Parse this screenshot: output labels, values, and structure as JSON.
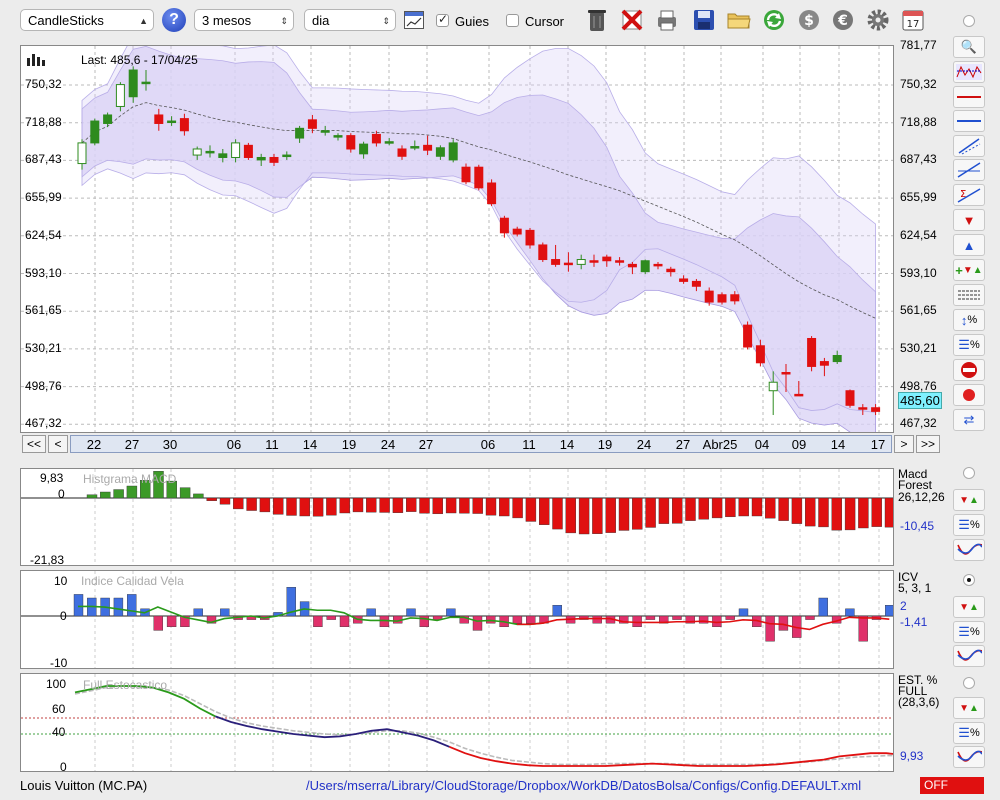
{
  "toolbar": {
    "chart_type": "CandleSticks",
    "period": "3 mesos",
    "interval": "dia",
    "guides_label": "Guies",
    "guides_checked": true,
    "cursor_label": "Cursor",
    "cursor_checked": false,
    "calendar_day": "17"
  },
  "main_chart": {
    "last_label": "Last: 485,6 - 17/04/25",
    "current_price": "485,60",
    "price_ticks": [
      "750,32",
      "718,88",
      "687,43",
      "655,99",
      "624,54",
      "593,10",
      "561,65",
      "530,21",
      "498,76",
      "467,32"
    ],
    "top_partial_tick": "781,77",
    "nav_prev_fast": "<<",
    "nav_prev": "<",
    "nav_next": ">",
    "nav_next_fast": ">>",
    "date_ticks": [
      "22",
      "27",
      "30",
      "06",
      "11",
      "14",
      "19",
      "24",
      "27",
      "06",
      "11",
      "14",
      "19",
      "24",
      "27",
      "Abr25",
      "04",
      "09",
      "14",
      "17"
    ]
  },
  "macd_pane": {
    "title": "Histgrama MACD",
    "name": "Macd",
    "name2": "Forest",
    "params": "26,12,26",
    "value": "-10,45",
    "scale_top": "9,83",
    "scale_zero": "0",
    "scale_bottom": "-21,83"
  },
  "icv_pane": {
    "title": "Indice Calidad Vela",
    "name": "ICV",
    "params": "5, 3, 1",
    "value1": "2",
    "value2": "-1,41",
    "scale_top": "10",
    "scale_zero": "0",
    "scale_bottom": "-10"
  },
  "stoch_pane": {
    "title": "Full Estocastico",
    "name": "EST. %",
    "name2": "FULL",
    "params": "(28,3,6)",
    "value": "9,93",
    "scale_100": "100",
    "scale_60": "60",
    "scale_40": "40",
    "scale_0": "0"
  },
  "status": {
    "symbol": "Louis Vuitton (MC.PA)",
    "path": "/Users/mserra/Library/CloudStorage/Dropbox/WorkDB/DatosBolsa/Configs/Config.DEFAULT.xml",
    "state": "OFF"
  },
  "colors": {
    "up": "#2e8b1e",
    "down": "#e01010",
    "band": "#d9d2f5",
    "macd_pos": "#3c9a28",
    "icv_pos": "#3f6fe0",
    "icv_neg": "#e0306a",
    "signal_green": "#2a9a1a",
    "signal_red": "#e01010",
    "stoch_navy": "#2a1f7a"
  },
  "chart_data": {
    "type": "candlestick",
    "y_range": [
      467.32,
      781.77
    ],
    "candles": [
      {
        "o": 685,
        "c": 702,
        "h": 705,
        "l": 680
      },
      {
        "o": 702,
        "c": 720,
        "h": 722,
        "l": 700
      },
      {
        "o": 718,
        "c": 725,
        "h": 727,
        "l": 715
      },
      {
        "o": 732,
        "c": 750,
        "h": 752,
        "l": 728
      },
      {
        "o": 740,
        "c": 762,
        "h": 765,
        "l": 735
      },
      {
        "o": 752,
        "c": 752,
        "h": 762,
        "l": 745
      },
      {
        "o": 725,
        "c": 718,
        "h": 730,
        "l": 712
      },
      {
        "o": 720,
        "c": 720,
        "h": 724,
        "l": 716
      },
      {
        "o": 722,
        "c": 712,
        "h": 726,
        "l": 708
      },
      {
        "o": 692,
        "c": 697,
        "h": 699,
        "l": 688
      },
      {
        "o": 695,
        "c": 695,
        "h": 700,
        "l": 690
      },
      {
        "o": 690,
        "c": 693,
        "h": 697,
        "l": 686
      },
      {
        "o": 690,
        "c": 702,
        "h": 705,
        "l": 686
      },
      {
        "o": 700,
        "c": 690,
        "h": 702,
        "l": 688
      },
      {
        "o": 688,
        "c": 690,
        "h": 693,
        "l": 683
      },
      {
        "o": 690,
        "c": 686,
        "h": 693,
        "l": 683
      },
      {
        "o": 692,
        "c": 692,
        "h": 695,
        "l": 688
      },
      {
        "o": 706,
        "c": 714,
        "h": 716,
        "l": 702
      },
      {
        "o": 721,
        "c": 714,
        "h": 725,
        "l": 710
      },
      {
        "o": 712,
        "c": 712,
        "h": 716,
        "l": 708
      },
      {
        "o": 708,
        "c": 708,
        "h": 710,
        "l": 704
      },
      {
        "o": 708,
        "c": 697,
        "h": 710,
        "l": 694
      },
      {
        "o": 693,
        "c": 701,
        "h": 703,
        "l": 689
      },
      {
        "o": 709,
        "c": 702,
        "h": 712,
        "l": 699
      },
      {
        "o": 703,
        "c": 703,
        "h": 706,
        "l": 700
      },
      {
        "o": 697,
        "c": 691,
        "h": 700,
        "l": 688
      },
      {
        "o": 699,
        "c": 699,
        "h": 704,
        "l": 696
      },
      {
        "o": 700,
        "c": 696,
        "h": 708,
        "l": 692
      },
      {
        "o": 691,
        "c": 698,
        "h": 700,
        "l": 688
      },
      {
        "o": 688,
        "c": 702,
        "h": 705,
        "l": 686
      },
      {
        "o": 682,
        "c": 670,
        "h": 685,
        "l": 668
      },
      {
        "o": 682,
        "c": 665,
        "h": 684,
        "l": 663
      },
      {
        "o": 669,
        "c": 652,
        "h": 672,
        "l": 650
      },
      {
        "o": 640,
        "c": 628,
        "h": 642,
        "l": 624
      },
      {
        "o": 631,
        "c": 627,
        "h": 633,
        "l": 625
      },
      {
        "o": 630,
        "c": 618,
        "h": 632,
        "l": 615
      },
      {
        "o": 618,
        "c": 606,
        "h": 620,
        "l": 604
      },
      {
        "o": 606,
        "c": 602,
        "h": 618,
        "l": 600
      },
      {
        "o": 603,
        "c": 603,
        "h": 612,
        "l": 596
      },
      {
        "o": 602,
        "c": 606,
        "h": 610,
        "l": 598
      },
      {
        "o": 605,
        "c": 605,
        "h": 610,
        "l": 600
      },
      {
        "o": 608,
        "c": 605,
        "h": 610,
        "l": 600
      },
      {
        "o": 605,
        "c": 605,
        "h": 608,
        "l": 601
      },
      {
        "o": 602,
        "c": 600,
        "h": 604,
        "l": 594
      },
      {
        "o": 596,
        "c": 605,
        "h": 606,
        "l": 594
      },
      {
        "o": 602,
        "c": 602,
        "h": 604,
        "l": 598
      },
      {
        "o": 598,
        "c": 596,
        "h": 600,
        "l": 592
      },
      {
        "o": 590,
        "c": 588,
        "h": 593,
        "l": 586
      },
      {
        "o": 588,
        "c": 584,
        "h": 590,
        "l": 580
      },
      {
        "o": 580,
        "c": 571,
        "h": 583,
        "l": 568
      },
      {
        "o": 577,
        "c": 571,
        "h": 579,
        "l": 569
      },
      {
        "o": 577,
        "c": 572,
        "h": 580,
        "l": 569
      },
      {
        "o": 552,
        "c": 534,
        "h": 555,
        "l": 532
      },
      {
        "o": 535,
        "c": 521,
        "h": 540,
        "l": 518
      },
      {
        "o": 498,
        "c": 505,
        "h": 514,
        "l": 478
      },
      {
        "o": 513,
        "c": 513,
        "h": 520,
        "l": 497
      },
      {
        "o": 495,
        "c": 495,
        "h": 506,
        "l": 494
      },
      {
        "o": 541,
        "c": 518,
        "h": 543,
        "l": 514
      },
      {
        "o": 522,
        "c": 519,
        "h": 525,
        "l": 510
      },
      {
        "o": 522,
        "c": 527,
        "h": 531,
        "l": 520
      },
      {
        "o": 498,
        "c": 486,
        "h": 499,
        "l": 484
      },
      {
        "o": 484,
        "c": 484,
        "h": 487,
        "l": 478
      },
      {
        "o": 484,
        "c": 481,
        "h": 487,
        "l": 478
      }
    ],
    "macd_hist": [
      1.2,
      2.2,
      3.1,
      4.4,
      6.5,
      9.8,
      6.2,
      3.8,
      1.5,
      -1.0,
      -2.3,
      -4.0,
      -4.6,
      -5.1,
      -6.0,
      -6.4,
      -6.6,
      -6.7,
      -6.3,
      -5.5,
      -5.1,
      -5.2,
      -5.3,
      -5.4,
      -5.0,
      -5.6,
      -5.8,
      -5.5,
      -5.6,
      -5.7,
      -6.3,
      -6.6,
      -7.3,
      -8.6,
      -9.8,
      -11.4,
      -12.8,
      -13.2,
      -13.1,
      -12.7,
      -11.9,
      -11.5,
      -10.8,
      -9.4,
      -9.3,
      -8.3,
      -7.8,
      -7.3,
      -6.9,
      -6.6,
      -6.6,
      -7.4,
      -8.3,
      -9.4,
      -10.3,
      -10.6,
      -11.8,
      -11.7,
      -11.0,
      -10.5,
      -10.7,
      -10.5
    ],
    "icv_bars": [
      6,
      5,
      5,
      5,
      6,
      2,
      -4,
      -3,
      -3,
      2,
      -2,
      2,
      -1,
      -1,
      -1,
      1,
      8,
      4,
      -3,
      -1,
      -3,
      -2,
      2,
      -3,
      -2,
      2,
      -3,
      -1,
      2,
      -2,
      -4,
      -2,
      -3,
      -2,
      -2,
      -2,
      3,
      -2,
      -1,
      -2,
      -2,
      -2,
      -3,
      -1,
      -2,
      -1,
      -2,
      -2,
      -3,
      -1,
      2,
      -3,
      -7,
      -4,
      -6,
      -1,
      5,
      -2,
      2,
      -7,
      -1,
      3
    ]
  }
}
